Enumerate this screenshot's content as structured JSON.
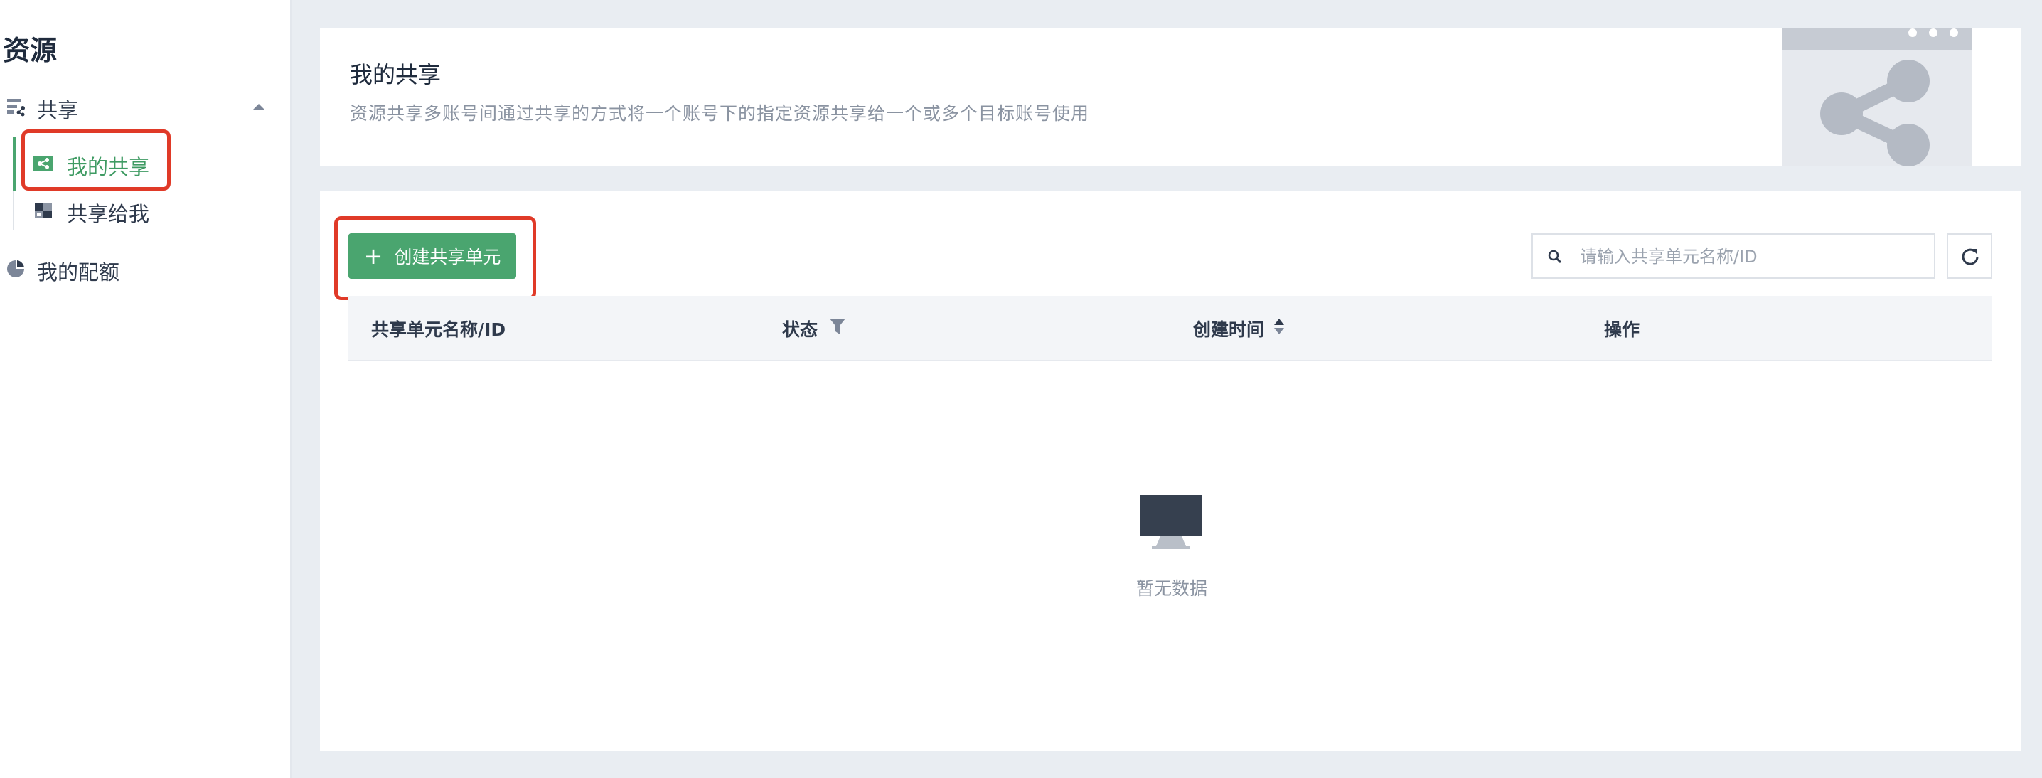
{
  "sidebar": {
    "title": "资源",
    "group": {
      "label": "共享",
      "icon": "share-group-icon"
    },
    "items": [
      {
        "label": "我的共享",
        "icon": "share-icon",
        "active": true
      },
      {
        "label": "共享给我",
        "icon": "shared-to-me-icon",
        "active": false
      }
    ],
    "quota": {
      "label": "我的配额",
      "icon": "pie-chart-icon"
    }
  },
  "header": {
    "title": "我的共享",
    "description": "资源共享多账号间通过共享的方式将一个账号下的指定资源共享给一个或多个目标账号使用"
  },
  "toolbar": {
    "create_label": "创建共享单元",
    "search_placeholder": "请输入共享单元名称/ID"
  },
  "table": {
    "columns": [
      "共享单元名称/ID",
      "状态",
      "创建时间",
      "操作"
    ]
  },
  "empty": {
    "text": "暂无数据"
  },
  "colors": {
    "accent": "#4aa56f",
    "highlight": "#e03a28"
  }
}
